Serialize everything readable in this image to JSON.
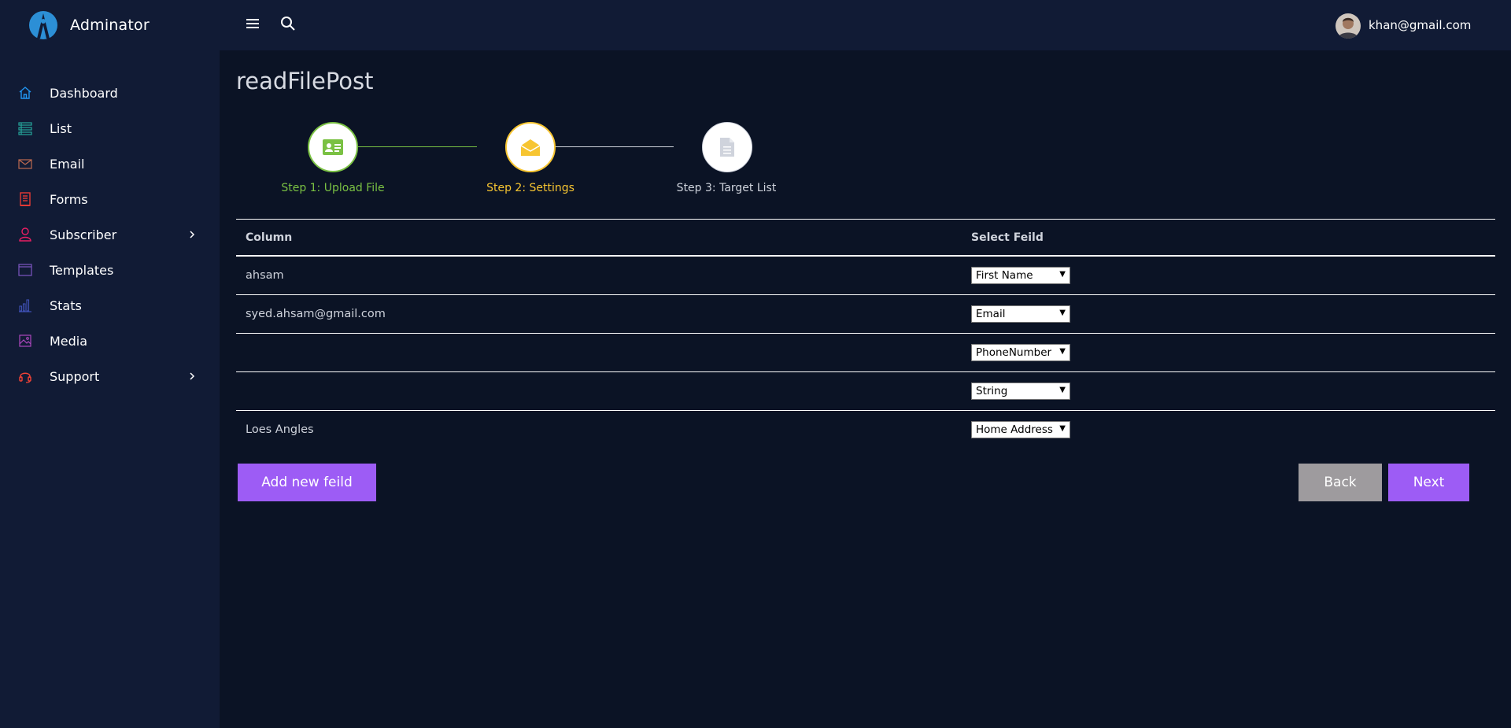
{
  "brand": {
    "name": "Adminator",
    "icon": "adminator-logo"
  },
  "sidebar": {
    "items": [
      {
        "label": "Dashboard",
        "icon": "home-icon",
        "color": "#2196f3",
        "has_submenu": false
      },
      {
        "label": "List",
        "icon": "list-icon",
        "color": "#26a69a",
        "has_submenu": false
      },
      {
        "label": "Email",
        "icon": "mail-icon",
        "color": "#bd6a50",
        "has_submenu": false
      },
      {
        "label": "Forms",
        "icon": "forms-icon",
        "color": "#e53935",
        "has_submenu": false
      },
      {
        "label": "Subscriber",
        "icon": "user-icon",
        "color": "#e91e63",
        "has_submenu": true
      },
      {
        "label": "Templates",
        "icon": "window-icon",
        "color": "#7e57c2",
        "has_submenu": false
      },
      {
        "label": "Stats",
        "icon": "bar-chart-icon",
        "color": "#3f51b5",
        "has_submenu": false
      },
      {
        "label": "Media",
        "icon": "image-icon",
        "color": "#ab47bc",
        "has_submenu": false
      },
      {
        "label": "Support",
        "icon": "headset-icon",
        "color": "#f44336",
        "has_submenu": true
      }
    ]
  },
  "header": {
    "menu_icon": "hamburger-icon",
    "search_icon": "search-icon",
    "user_email": "khan@gmail.com"
  },
  "main": {
    "title": "readFilePost",
    "steps": [
      {
        "label": "Step 1: Upload File",
        "icon": "id-card-icon",
        "color": "#7ac143",
        "state": "complete"
      },
      {
        "label": "Step 2: Settings",
        "icon": "envelope-open-icon",
        "color": "#f7c531",
        "state": "active"
      },
      {
        "label": "Step 3: Target List",
        "icon": "document-icon",
        "color": "#cfd3dc",
        "state": "pending"
      }
    ],
    "table": {
      "headers": {
        "column": "Column",
        "select": "Select Feild"
      },
      "rows": [
        {
          "column": "ahsam",
          "field": "First Name"
        },
        {
          "column": "syed.ahsam@gmail.com",
          "field": "Email"
        },
        {
          "column": "",
          "field": "PhoneNumber"
        },
        {
          "column": "",
          "field": "String"
        },
        {
          "column": "Loes Angles",
          "field": "Home Address"
        }
      ]
    },
    "buttons": {
      "add": "Add new feild",
      "back": "Back",
      "next": "Next"
    }
  },
  "colors": {
    "accent": "#9d5cf5",
    "back_button": "#9e9b9e",
    "background": "#0b1325",
    "panel": "#111b35"
  }
}
